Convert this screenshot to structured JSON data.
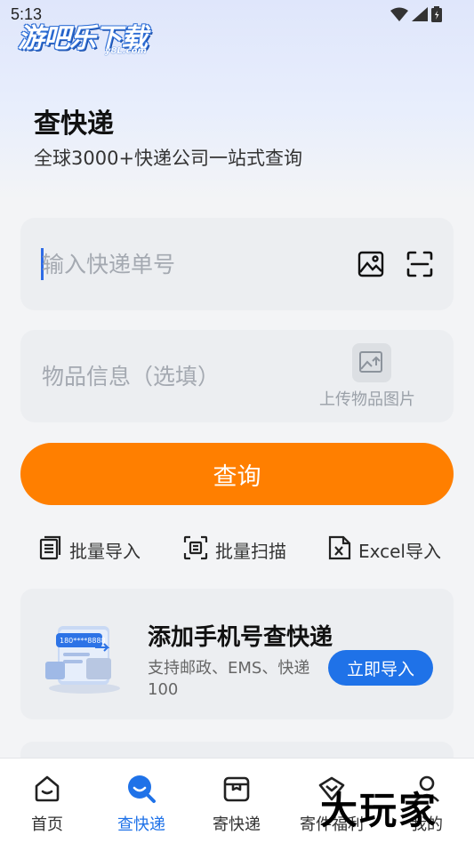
{
  "status_bar": {
    "time": "5:13"
  },
  "watermark": {
    "logo": "游吧乐下载",
    "domain": "y8L.com",
    "corner": "大玩家"
  },
  "header": {
    "title": "查快递",
    "subtitle": "全球3000+快递公司一站式查询"
  },
  "tracking": {
    "placeholder": "输入快递单号",
    "value": "",
    "image_icon": "image-icon",
    "scan_icon": "scan-icon"
  },
  "item_info": {
    "placeholder": "物品信息（选填）",
    "upload_label": "上传物品图片",
    "upload_icon": "image-upload-icon"
  },
  "query_button": {
    "label": "查询",
    "color": "#ff7f00"
  },
  "tools": [
    {
      "label": "批量导入",
      "icon": "batch-import-icon"
    },
    {
      "label": "批量扫描",
      "icon": "batch-scan-icon"
    },
    {
      "label": "Excel导入",
      "icon": "excel-icon"
    }
  ],
  "promo": {
    "title": "添加手机号查快递",
    "description": "支持邮政、EMS、快递100",
    "button_label": "立即导入",
    "phone_text": "180****8888",
    "accent": "#1f72e8"
  },
  "bottom_nav": {
    "items": [
      {
        "label": "首页",
        "icon": "home-icon",
        "active": false
      },
      {
        "label": "查快递",
        "icon": "search-icon",
        "active": true
      },
      {
        "label": "寄快递",
        "icon": "package-icon",
        "active": false
      },
      {
        "label": "寄件福利",
        "icon": "gift-icon",
        "active": false
      },
      {
        "label": "我的",
        "icon": "profile-icon",
        "active": false
      }
    ]
  }
}
